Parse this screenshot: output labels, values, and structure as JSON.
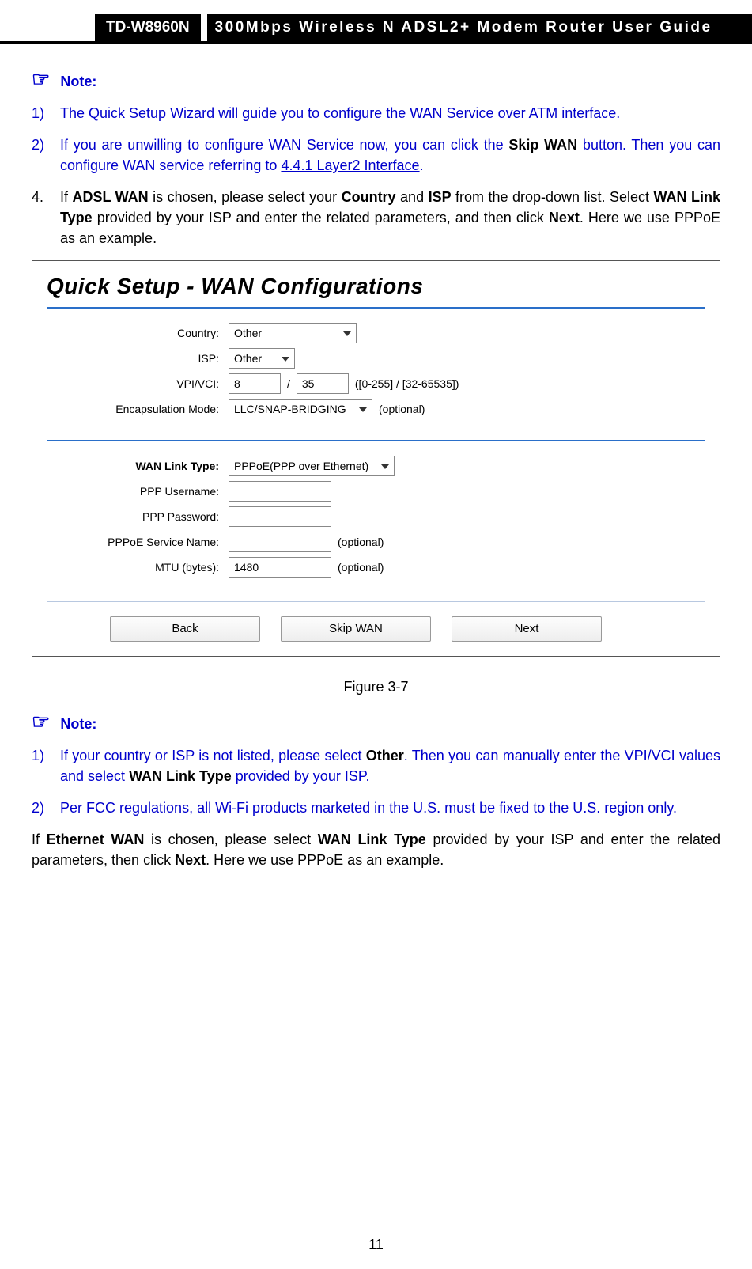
{
  "header": {
    "model": "TD-W8960N",
    "title": "300Mbps Wireless N ADSL2+ Modem Router User Guide"
  },
  "note1": {
    "label": "Note:",
    "items": [
      {
        "n": "1)",
        "text_a": "The Quick Setup Wizard will guide you to configure the WAN Service over ATM interface."
      },
      {
        "n": "2)",
        "text_a": "If you are unwilling to configure WAN Service now, you can click the ",
        "bold1": "Skip WAN",
        "text_b": " button. Then you can configure WAN service referring to ",
        "link": "4.4.1 Layer2 Interface",
        "text_c": "."
      }
    ]
  },
  "step4": {
    "n": "4.",
    "t1": "If ",
    "b1": "ADSL WAN",
    "t2": " is chosen, please select your ",
    "b2": "Country",
    "t3": " and ",
    "b3": "ISP",
    "t4": " from the drop-down list. Select ",
    "b4": "WAN Link Type",
    "t5": " provided by your ISP and enter the related parameters, and then click ",
    "b5": "Next",
    "t6": ". Here we use PPPoE as an example."
  },
  "fig": {
    "title": "Quick Setup - WAN Configurations",
    "caption": "Figure 3-7",
    "fields": {
      "country_label": "Country:",
      "country_value": "Other",
      "isp_label": "ISP:",
      "isp_value": "Other",
      "vpi_label": "VPI/VCI:",
      "vpi_value": "8",
      "vci_value": "35",
      "vpi_range": "([0-255] / [32-65535])",
      "encap_label": "Encapsulation Mode:",
      "encap_value": "LLC/SNAP-BRIDGING",
      "optional": "(optional)",
      "wan_label": "WAN Link Type:",
      "wan_value": "PPPoE(PPP over Ethernet)",
      "ppp_user_label": "PPP Username:",
      "ppp_pass_label": "PPP Password:",
      "svc_label": "PPPoE Service Name:",
      "mtu_label": "MTU (bytes):",
      "mtu_value": "1480",
      "slash": "/"
    },
    "buttons": {
      "back": "Back",
      "skip": "Skip WAN",
      "next": "Next"
    }
  },
  "note2": {
    "label": "Note:",
    "items": [
      {
        "n": "1)",
        "t1": "If your country or ISP is not listed, please select ",
        "b1": "Other",
        "t2": ". Then you can manually enter the VPI/VCI values and select ",
        "b2": "WAN Link Type",
        "t3": " provided by your ISP."
      },
      {
        "n": "2)",
        "t1": "Per FCC regulations, all Wi-Fi products marketed in the U.S. must be fixed to the U.S. region only."
      }
    ]
  },
  "para_eth": {
    "t1": "If ",
    "b1": "Ethernet WAN",
    "t2": " is chosen, please select ",
    "b2": "WAN Link Type",
    "t3": " provided by your ISP and enter the related parameters, then click ",
    "b3": "Next",
    "t4": ". Here we use PPPoE as an example."
  },
  "page_number": "11"
}
